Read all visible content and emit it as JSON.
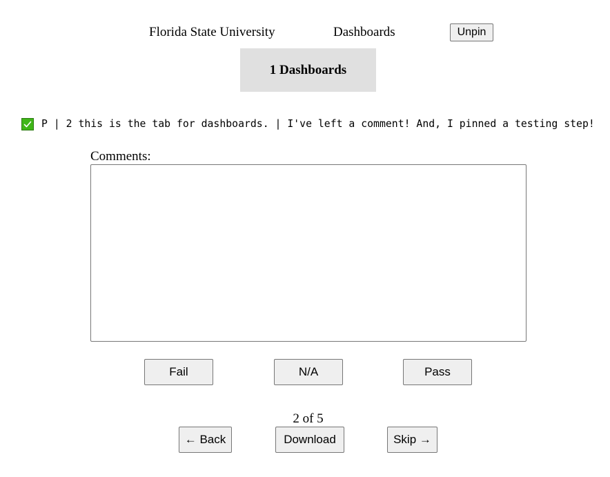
{
  "header": {
    "organization": "Florida State University",
    "section": "Dashboards",
    "unpin_label": "Unpin"
  },
  "tab": {
    "title": "1 Dashboards"
  },
  "status": {
    "icon": "checkmark-icon",
    "color": "#3fb618",
    "text": "P | 2 this is the tab for dashboards. | I've left a comment! And, I pinned a testing step!"
  },
  "comments": {
    "label": "Comments:",
    "value": ""
  },
  "actions": {
    "fail_label": "Fail",
    "na_label": "N/A",
    "pass_label": "Pass"
  },
  "pagination": {
    "counter": "2 of 5",
    "back_label": "← Back",
    "download_label": "Download",
    "skip_label": "Skip →"
  }
}
